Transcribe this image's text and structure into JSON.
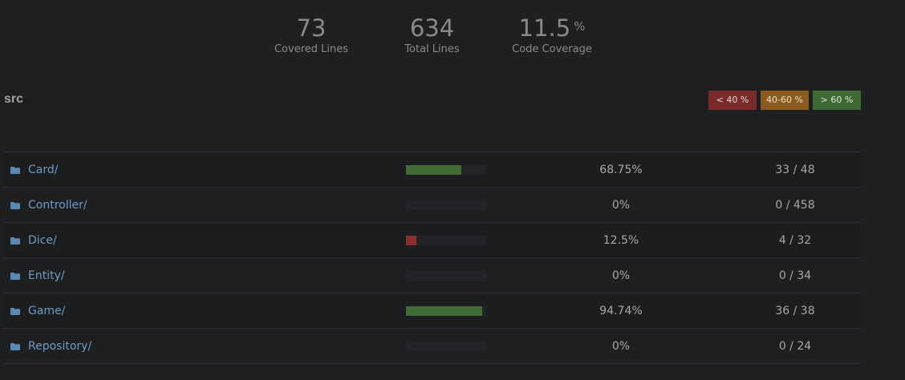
{
  "stats": {
    "covered_lines": "73",
    "covered_label": "Covered Lines",
    "total_lines": "634",
    "total_label": "Total Lines",
    "coverage": "11.5",
    "coverage_unit": "%",
    "coverage_label": "Code Coverage"
  },
  "section": {
    "title": "src"
  },
  "legend": {
    "low": "< 40 %",
    "mid": "40-60 %",
    "high": "> 60 %"
  },
  "colors": {
    "low": "#8a2e2e",
    "mid": "#9a6a22",
    "high": "#3f6b35"
  },
  "rows": [
    {
      "name": "Card/",
      "percent": "68.75%",
      "coverage": 0.6875,
      "lines": "33 / 48",
      "level": "high"
    },
    {
      "name": "Controller/",
      "percent": "0%",
      "coverage": 0,
      "lines": "0 / 458",
      "level": "low"
    },
    {
      "name": "Dice/",
      "percent": "12.5%",
      "coverage": 0.125,
      "lines": "4 / 32",
      "level": "low"
    },
    {
      "name": "Entity/",
      "percent": "0%",
      "coverage": 0,
      "lines": "0 / 34",
      "level": "low"
    },
    {
      "name": "Game/",
      "percent": "94.74%",
      "coverage": 0.9474,
      "lines": "36 / 38",
      "level": "high"
    },
    {
      "name": "Repository/",
      "percent": "0%",
      "coverage": 0,
      "lines": "0 / 24",
      "level": "low"
    }
  ],
  "icons": {
    "folder": "folder-icon"
  }
}
